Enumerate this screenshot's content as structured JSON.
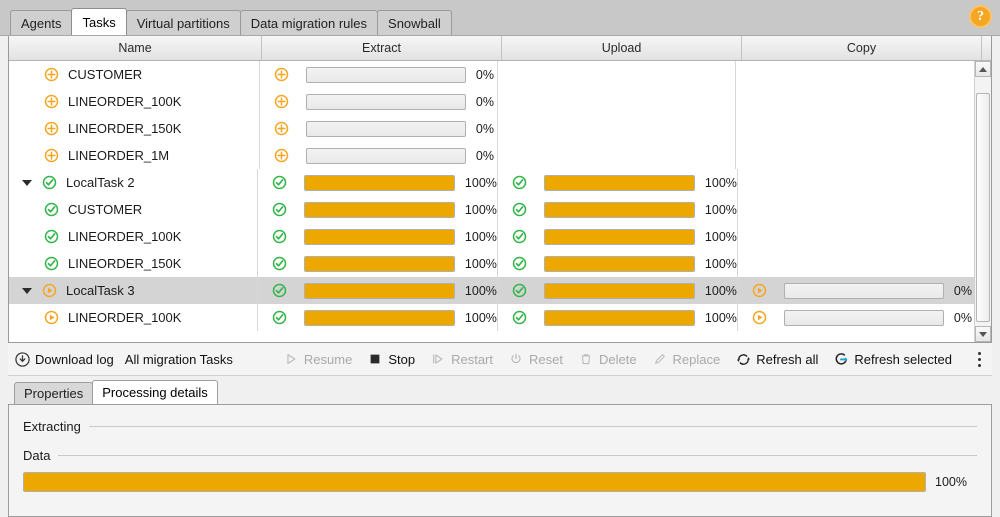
{
  "window": {
    "top_tabs": [
      {
        "label": "Agents",
        "active": false
      },
      {
        "label": "Tasks",
        "active": true
      },
      {
        "label": "Virtual partitions",
        "active": false
      },
      {
        "label": "Data migration rules",
        "active": false
      },
      {
        "label": "Snowball",
        "active": false
      }
    ],
    "help_icon": "help-icon",
    "help_glyph": "?"
  },
  "table": {
    "columns": [
      {
        "label": "Name"
      },
      {
        "label": "Extract"
      },
      {
        "label": "Upload"
      },
      {
        "label": "Copy"
      }
    ],
    "rows": [
      {
        "name": "CUSTOMER",
        "level": "child",
        "selected": false,
        "icon": "plus-circle-icon",
        "extract": {
          "icon": "plus-circle-icon",
          "pct": 0,
          "label": "0%"
        },
        "upload": null,
        "copy": null
      },
      {
        "name": "LINEORDER_100K",
        "level": "child",
        "selected": false,
        "icon": "plus-circle-icon",
        "extract": {
          "icon": "plus-circle-icon",
          "pct": 0,
          "label": "0%"
        },
        "upload": null,
        "copy": null
      },
      {
        "name": "LINEORDER_150K",
        "level": "child",
        "selected": false,
        "icon": "plus-circle-icon",
        "extract": {
          "icon": "plus-circle-icon",
          "pct": 0,
          "label": "0%"
        },
        "upload": null,
        "copy": null
      },
      {
        "name": "LINEORDER_1M",
        "level": "child",
        "selected": false,
        "icon": "plus-circle-icon",
        "extract": {
          "icon": "plus-circle-icon",
          "pct": 0,
          "label": "0%"
        },
        "upload": null,
        "copy": null
      },
      {
        "name": "LocalTask 2",
        "level": "parent",
        "selected": false,
        "icon": "check-circle-icon",
        "expanded": true,
        "extract": {
          "icon": "check-circle-icon",
          "pct": 100,
          "label": "100%"
        },
        "upload": {
          "icon": "check-circle-icon",
          "pct": 100,
          "label": "100%"
        },
        "copy": null
      },
      {
        "name": "CUSTOMER",
        "level": "child",
        "selected": false,
        "icon": "check-circle-icon",
        "extract": {
          "icon": "check-circle-icon",
          "pct": 100,
          "label": "100%"
        },
        "upload": {
          "icon": "check-circle-icon",
          "pct": 100,
          "label": "100%"
        },
        "copy": null
      },
      {
        "name": "LINEORDER_100K",
        "level": "child",
        "selected": false,
        "icon": "check-circle-icon",
        "extract": {
          "icon": "check-circle-icon",
          "pct": 100,
          "label": "100%"
        },
        "upload": {
          "icon": "check-circle-icon",
          "pct": 100,
          "label": "100%"
        },
        "copy": null
      },
      {
        "name": "LINEORDER_150K",
        "level": "child",
        "selected": false,
        "icon": "check-circle-icon",
        "extract": {
          "icon": "check-circle-icon",
          "pct": 100,
          "label": "100%"
        },
        "upload": {
          "icon": "check-circle-icon",
          "pct": 100,
          "label": "100%"
        },
        "copy": null
      },
      {
        "name": "LocalTask 3",
        "level": "parent",
        "selected": true,
        "icon": "play-circle-icon",
        "expanded": true,
        "extract": {
          "icon": "check-circle-icon",
          "pct": 100,
          "label": "100%"
        },
        "upload": {
          "icon": "check-circle-icon",
          "pct": 100,
          "label": "100%"
        },
        "copy": {
          "icon": "play-circle-icon",
          "pct": 0,
          "label": "0%"
        }
      },
      {
        "name": "LINEORDER_100K",
        "level": "child",
        "selected": false,
        "icon": "play-circle-icon",
        "extract": {
          "icon": "check-circle-icon",
          "pct": 100,
          "label": "100%"
        },
        "upload": {
          "icon": "check-circle-icon",
          "pct": 100,
          "label": "100%"
        },
        "copy": {
          "icon": "play-circle-icon",
          "pct": 0,
          "label": "0%"
        }
      }
    ],
    "scrollbar": {
      "up_arrow": "chevron-up-icon",
      "down_arrow": "chevron-down-icon"
    }
  },
  "toolbar": {
    "download_log": {
      "label": "Download log",
      "icon": "download-icon",
      "enabled": true
    },
    "scope_label": "All migration Tasks",
    "actions": [
      {
        "label": "Resume",
        "icon": "play-icon",
        "enabled": false
      },
      {
        "label": "Stop",
        "icon": "stop-icon",
        "enabled": true
      },
      {
        "label": "Restart",
        "icon": "restart-icon",
        "enabled": false
      },
      {
        "label": "Reset",
        "icon": "power-icon",
        "enabled": false
      },
      {
        "label": "Delete",
        "icon": "trash-icon",
        "enabled": false
      },
      {
        "label": "Replace",
        "icon": "pencil-icon",
        "enabled": false
      },
      {
        "label": "Refresh all",
        "icon": "refresh-icon",
        "enabled": true
      },
      {
        "label": "Refresh selected",
        "icon": "refresh-selected-icon",
        "enabled": true
      }
    ],
    "overflow_icon": "kebab-menu-icon"
  },
  "details": {
    "tabs": [
      {
        "label": "Properties",
        "active": false
      },
      {
        "label": "Processing details",
        "active": true
      }
    ],
    "sections": [
      {
        "title": "Extracting"
      },
      {
        "title": "Data"
      }
    ],
    "progress": {
      "pct": 100,
      "label": "100%"
    }
  },
  "colors": {
    "accent_orange": "#eda800",
    "status_green": "#33b54a",
    "status_orange": "#f5a623",
    "refresh_blue": "#1e9fd8"
  }
}
